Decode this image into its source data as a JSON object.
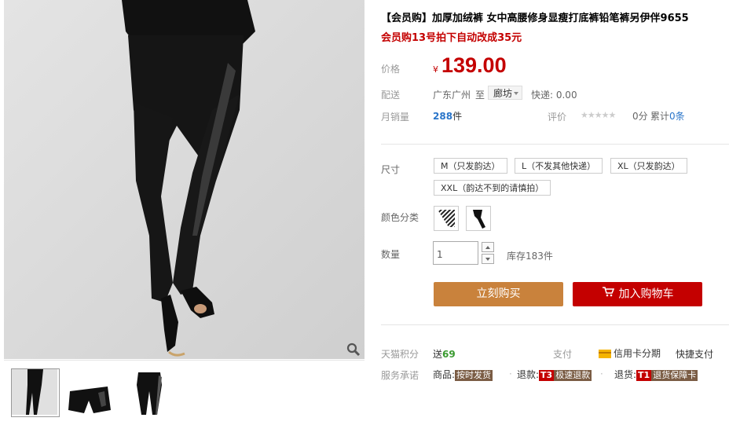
{
  "product": {
    "title": "【会员购】加厚加绒裤 女中高腰修身显瘦打底裤铅笔裤另伊伴9655",
    "promo": "会员购13号拍下自动改成35元"
  },
  "price": {
    "label": "价格",
    "currency": "¥",
    "value": "139.00"
  },
  "shipping": {
    "label": "配送",
    "from": "广东广州",
    "to_word": "至",
    "district": "廊坊",
    "fee": "快递: 0.00"
  },
  "sales": {
    "label": "月销量",
    "count": "288",
    "unit": "件",
    "rating_label": "评价",
    "stars": "★★★★★",
    "score": "0分",
    "cumulative_prefix": "累计",
    "cumulative_count": "0条"
  },
  "size": {
    "label": "尺寸",
    "options": [
      "M（只发韵达）",
      "L（不发其他快递）",
      "XL（只发韵达）",
      "XXL（韵达不到的请慎拍）"
    ]
  },
  "color": {
    "label": "颜色分类"
  },
  "quantity": {
    "label": "数量",
    "value": "1",
    "stock": "库存183件"
  },
  "actions": {
    "buy_now": "立刻购买",
    "add_to_cart": "加入购物车"
  },
  "points": {
    "label": "天猫积分",
    "send": "送",
    "value": "69",
    "pay_label": "支付",
    "credit": "信用卡分期",
    "quick_pay": "快捷支付"
  },
  "service": {
    "label": "服务承诺",
    "goods_prefix": "商品:",
    "goods_badge": "按时发货",
    "refund_prefix": "退款:",
    "refund_badge_tag": "T3",
    "refund_badge": "极速退款",
    "return_prefix": "退货:",
    "return_badge_tag": "T1",
    "return_badge": "退货保障卡"
  },
  "icons": {
    "zoom": "magnifier-icon",
    "cart": "cart-icon",
    "credit_card": "credit-card-icon"
  },
  "colors": {
    "price_red": "#c40000",
    "buy_button": "#c9823c",
    "cart_button": "#c40000",
    "link_blue": "#2a75c9"
  }
}
